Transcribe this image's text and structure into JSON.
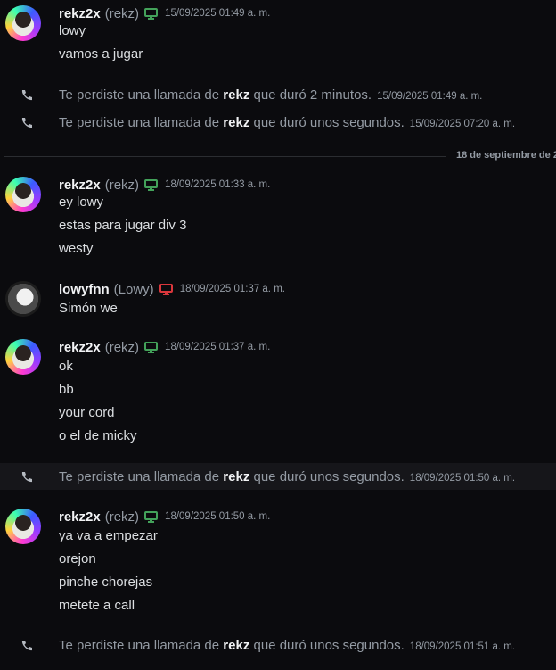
{
  "messages": [
    {
      "avatar": "rekz-avatar",
      "username": "rekz2x",
      "nick": "(rekz)",
      "device": "desktop-icon",
      "device_color": "#43a25a",
      "timestamp": "15/09/2025 01:49 a. m.",
      "lines": [
        "lowy",
        "vamos a jugar"
      ]
    },
    {
      "avatar": "rekz-avatar",
      "username": "rekz2x",
      "nick": "(rekz)",
      "device": "desktop-icon",
      "device_color": "#43a25a",
      "timestamp": "18/09/2025 01:33 a. m.",
      "lines": [
        "ey lowy",
        "estas para jugar div 3",
        "westy"
      ]
    },
    {
      "avatar": "lowy-avatar",
      "username": "lowyfnn",
      "nick": "(Lowy)",
      "device": "desktop-icon",
      "device_color": "#da373c",
      "timestamp": "18/09/2025 01:37 a. m.",
      "lines": [
        "Simón we"
      ]
    },
    {
      "avatar": "rekz-avatar",
      "username": "rekz2x",
      "nick": "(rekz)",
      "device": "desktop-icon",
      "device_color": "#43a25a",
      "timestamp": "18/09/2025 01:37 a. m.",
      "lines": [
        "ok",
        "bb",
        "your cord",
        "o el de micky"
      ]
    },
    {
      "avatar": "rekz-avatar",
      "username": "rekz2x",
      "nick": "(rekz)",
      "device": "desktop-icon",
      "device_color": "#43a25a",
      "timestamp": "18/09/2025 01:50 a. m.",
      "lines": [
        "ya va a empezar",
        "orejon",
        "pinche chorejas",
        "metete a call"
      ]
    }
  ],
  "calls": [
    {
      "prefix": "Te perdiste una llamada de ",
      "caller": "rekz",
      "suffix": " que duró 2 minutos.",
      "timestamp": "15/09/2025 01:49 a. m."
    },
    {
      "prefix": "Te perdiste una llamada de ",
      "caller": "rekz",
      "suffix": " que duró unos segundos.",
      "timestamp": "15/09/2025 07:20 a. m."
    },
    {
      "prefix": "Te perdiste una llamada de ",
      "caller": "rekz",
      "suffix": " que duró unos segundos.",
      "timestamp": "18/09/2025 01:50 a. m."
    },
    {
      "prefix": "Te perdiste una llamada de ",
      "caller": "rekz",
      "suffix": " que duró unos segundos.",
      "timestamp": "18/09/2025 01:51 a. m."
    }
  ],
  "date_divider": "18 de septiembre de 2"
}
